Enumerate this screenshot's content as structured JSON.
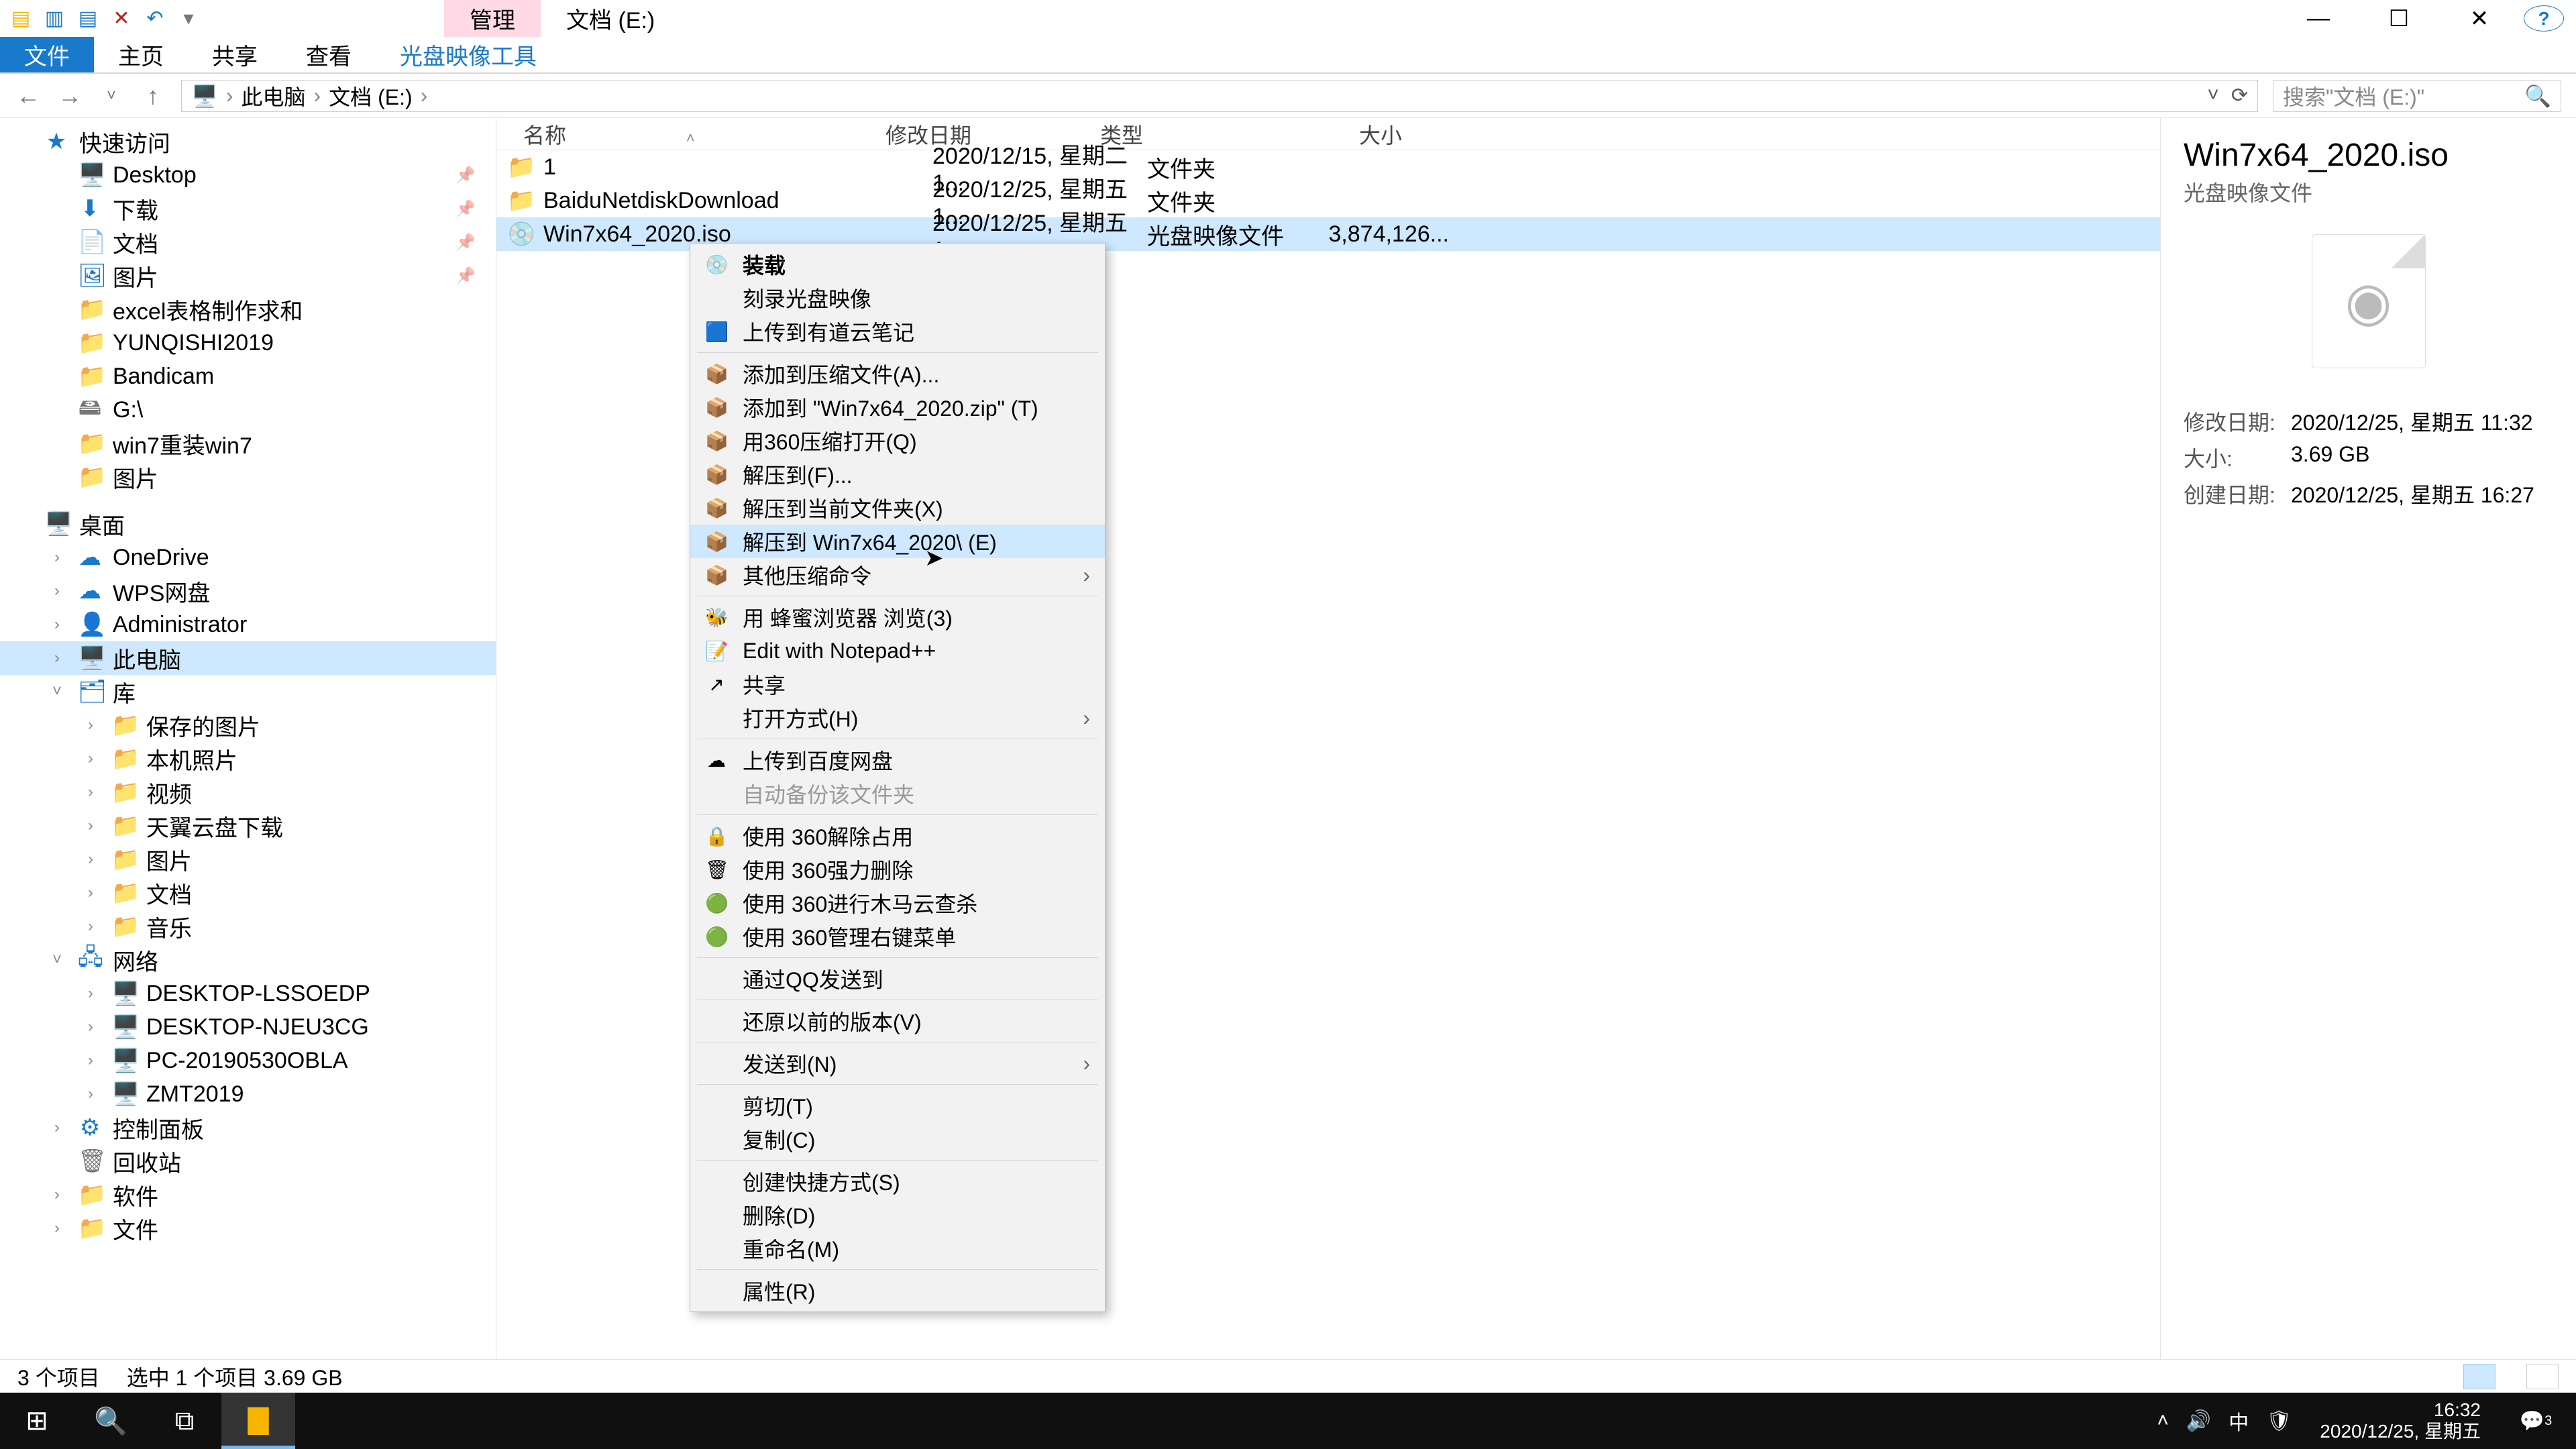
{
  "window": {
    "context_tab": "管理",
    "title": "文档 (E:)",
    "ribbon": {
      "file": "文件",
      "home": "主页",
      "share": "共享",
      "view": "查看",
      "disc_tools": "光盘映像工具"
    }
  },
  "address": {
    "root": "此电脑",
    "loc": "文档 (E:)",
    "search_placeholder": "搜索\"文档 (E:)\""
  },
  "tree": {
    "quick": "快速访问",
    "desktop": "Desktop",
    "downloads": "下载",
    "documents": "文档",
    "pictures_qa": "图片",
    "excel": "excel表格制作求和",
    "yunqishi": "YUNQISHI2019",
    "bandicam": "Bandicam",
    "gdrive": "G:\\",
    "win7reinstall": "win7重装win7",
    "pictures2": "图片",
    "desktop2": "桌面",
    "onedrive": "OneDrive",
    "wps": "WPS网盘",
    "admin": "Administrator",
    "thispc": "此电脑",
    "libs": "库",
    "saved_pics": "保存的图片",
    "camera_roll": "本机照片",
    "videos": "视频",
    "tianyi": "天翼云盘下载",
    "pictures_lib": "图片",
    "docs_lib": "文档",
    "music": "音乐",
    "network": "网络",
    "pc1": "DESKTOP-LSSOEDP",
    "pc2": "DESKTOP-NJEU3CG",
    "pc3": "PC-20190530OBLA",
    "pc4": "ZMT2019",
    "cpanel": "控制面板",
    "recycle": "回收站",
    "soft": "软件",
    "file": "文件"
  },
  "columns": {
    "name": "名称",
    "date": "修改日期",
    "type": "类型",
    "size": "大小"
  },
  "rows": [
    {
      "ico": "📁",
      "name": "1",
      "date": "2020/12/15, 星期二 1...",
      "type": "文件夹",
      "size": ""
    },
    {
      "ico": "📁",
      "name": "BaiduNetdiskDownload",
      "date": "2020/12/25, 星期五 1...",
      "type": "文件夹",
      "size": ""
    },
    {
      "ico": "💿",
      "name": "Win7x64_2020.iso",
      "date": "2020/12/25, 星期五 1...",
      "type": "光盘映像文件",
      "size": "3,874,126..."
    }
  ],
  "preview": {
    "title": "Win7x64_2020.iso",
    "subtitle": "光盘映像文件",
    "mod_k": "修改日期:",
    "mod_v": "2020/12/25, 星期五 11:32",
    "size_k": "大小:",
    "size_v": "3.69 GB",
    "create_k": "创建日期:",
    "create_v": "2020/12/25, 星期五 16:27"
  },
  "context_menu": [
    {
      "icon": "💿",
      "label": "装载",
      "bold": true
    },
    {
      "icon": "",
      "label": "刻录光盘映像"
    },
    {
      "icon": "🟦",
      "label": "上传到有道云笔记"
    },
    {
      "sep": true
    },
    {
      "icon": "📦",
      "label": "添加到压缩文件(A)..."
    },
    {
      "icon": "📦",
      "label": "添加到 \"Win7x64_2020.zip\" (T)"
    },
    {
      "icon": "📦",
      "label": "用360压缩打开(Q)"
    },
    {
      "icon": "📦",
      "label": "解压到(F)..."
    },
    {
      "icon": "📦",
      "label": "解压到当前文件夹(X)"
    },
    {
      "icon": "📦",
      "label": "解压到 Win7x64_2020\\ (E)",
      "hover": true
    },
    {
      "icon": "📦",
      "label": "其他压缩命令",
      "sub": true
    },
    {
      "sep": true
    },
    {
      "icon": "🐝",
      "label": "用 蜂蜜浏览器 浏览(3)"
    },
    {
      "icon": "📝",
      "label": "Edit with Notepad++"
    },
    {
      "icon": "↗",
      "label": "共享"
    },
    {
      "icon": "",
      "label": "打开方式(H)",
      "sub": true
    },
    {
      "sep": true
    },
    {
      "icon": "☁",
      "label": "上传到百度网盘"
    },
    {
      "icon": "",
      "label": "自动备份该文件夹",
      "disabled": true
    },
    {
      "sep": true
    },
    {
      "icon": "🔒",
      "label": "使用 360解除占用"
    },
    {
      "icon": "🗑",
      "label": "使用 360强力删除"
    },
    {
      "icon": "🟢",
      "label": "使用 360进行木马云查杀"
    },
    {
      "icon": "🟢",
      "label": "使用 360管理右键菜单"
    },
    {
      "sep": true
    },
    {
      "icon": "",
      "label": "通过QQ发送到"
    },
    {
      "sep": true
    },
    {
      "icon": "",
      "label": "还原以前的版本(V)"
    },
    {
      "sep": true
    },
    {
      "icon": "",
      "label": "发送到(N)",
      "sub": true
    },
    {
      "sep": true
    },
    {
      "icon": "",
      "label": "剪切(T)"
    },
    {
      "icon": "",
      "label": "复制(C)"
    },
    {
      "sep": true
    },
    {
      "icon": "",
      "label": "创建快捷方式(S)"
    },
    {
      "icon": "",
      "label": "删除(D)"
    },
    {
      "icon": "",
      "label": "重命名(M)"
    },
    {
      "sep": true
    },
    {
      "icon": "",
      "label": "属性(R)"
    }
  ],
  "status": {
    "count": "3 个项目",
    "selected": "选中 1 个项目  3.69 GB"
  },
  "taskbar": {
    "time": "16:32",
    "date": "2020/12/25, 星期五",
    "ime": "中",
    "notif_count": "3"
  }
}
